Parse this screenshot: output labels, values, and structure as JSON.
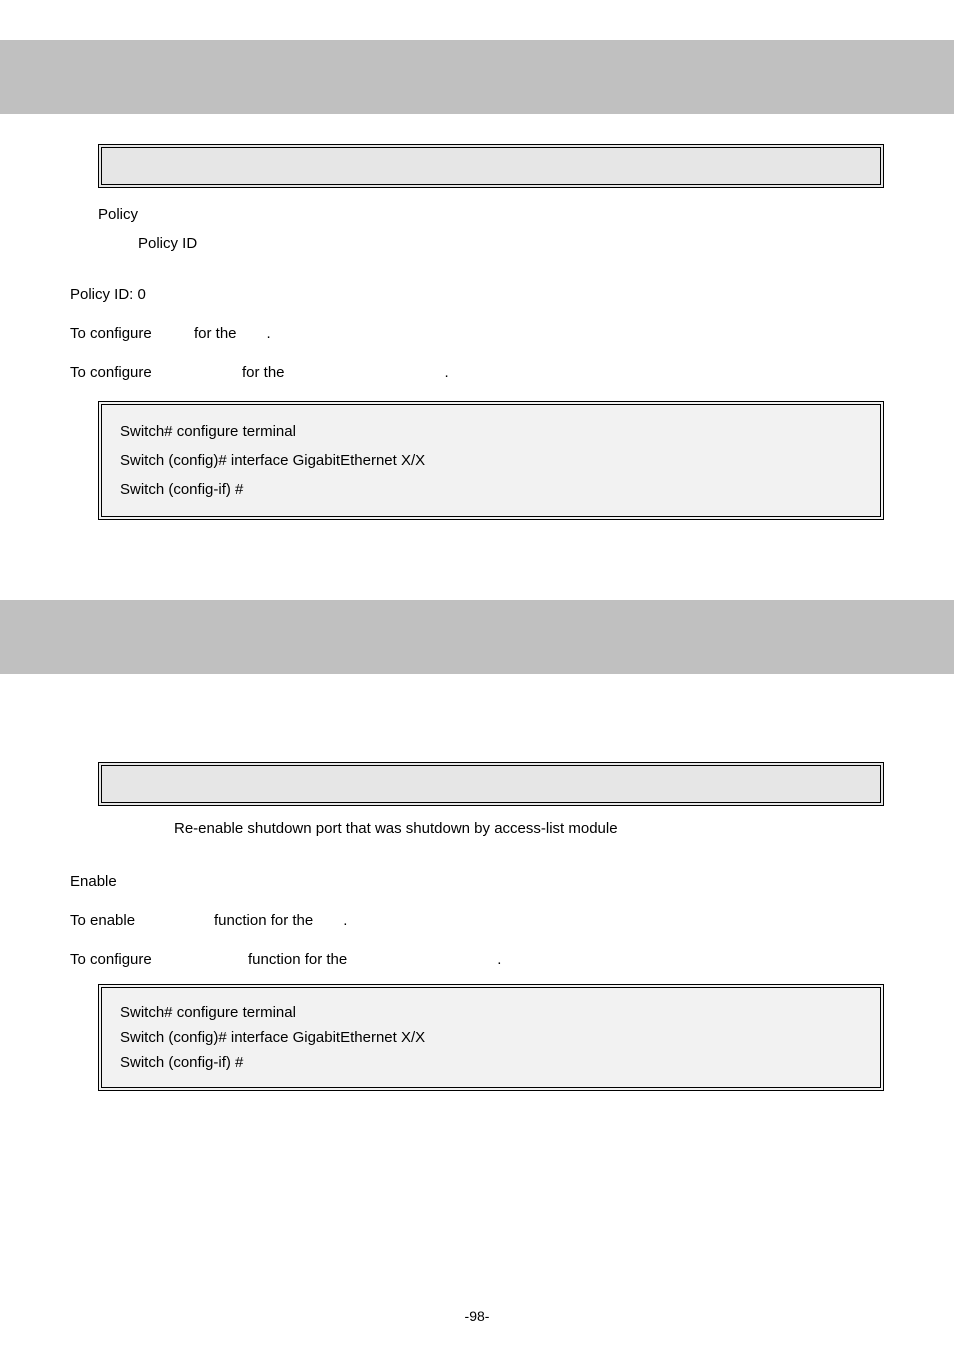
{
  "section1": {
    "paramLabel": "Policy",
    "paramSubLabel": "Policy ID",
    "defaultLine": "Policy ID: 0",
    "usage1_lead": "To configure",
    "usage1_mid": "for the",
    "usage1_end": ".",
    "usage2_lead": "To configure",
    "usage2_mid": "for the",
    "usage2_end": ".",
    "ex1": "Switch# configure terminal",
    "ex2": "Switch (config)# interface GigabitEthernet X/X",
    "ex3": "Switch (config-if) #"
  },
  "section2": {
    "desc": "Re-enable shutdown port that was shutdown by access-list module",
    "defaultVal": "Enable",
    "usage1_lead": "To enable",
    "usage1_mid": "function for the",
    "usage1_end": ".",
    "usage2_lead": "To configure",
    "usage2_mid": "function for the",
    "usage2_end": ".",
    "ex1": "Switch# configure terminal",
    "ex2": "Switch (config)# interface GigabitEthernet X/X",
    "ex3": "Switch (config-if) #"
  },
  "pageNum": "-98-"
}
